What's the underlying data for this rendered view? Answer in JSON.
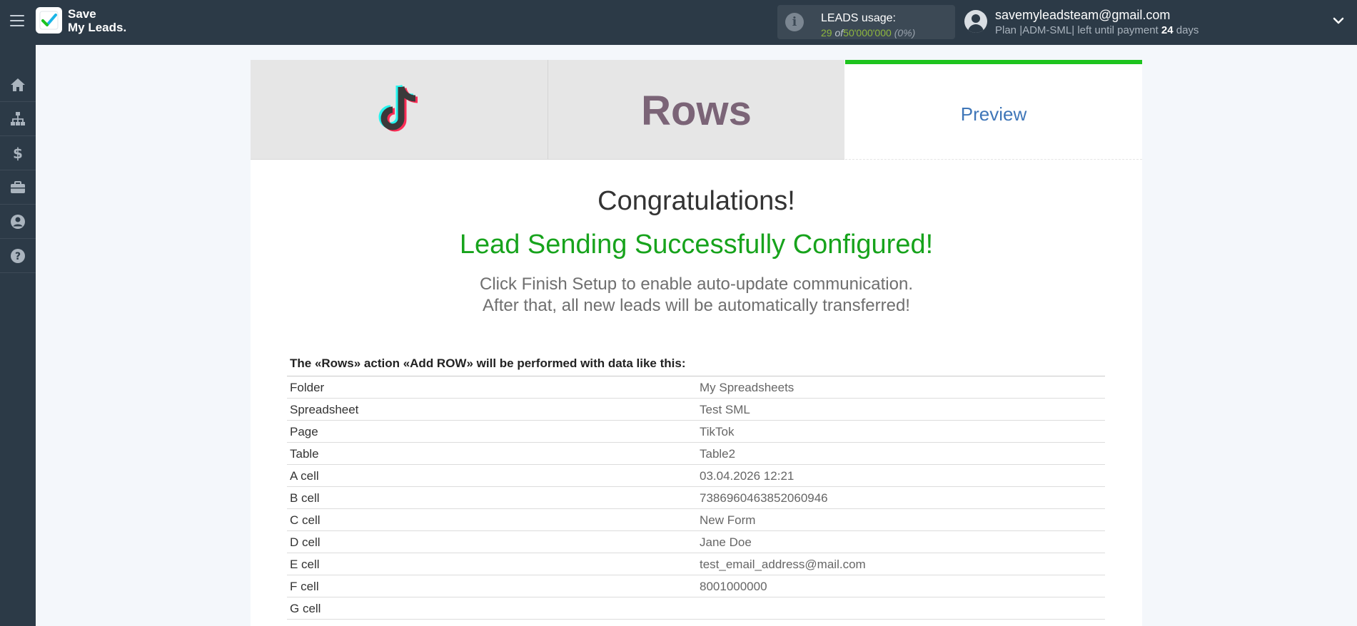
{
  "header": {
    "logo_line1": "Save",
    "logo_line2": "My Leads.",
    "usage_title": "LEADS usage:",
    "usage_used": "29",
    "usage_of": "of",
    "usage_total": "50'000'000",
    "usage_pct": "(0%)",
    "email": "savemyleadsteam@gmail.com",
    "plan_prefix": "Plan |ADM-SML| left until payment",
    "plan_days": "24",
    "plan_suffix": "days"
  },
  "sidebar": {
    "items": [
      "home-icon",
      "sitemap-icon",
      "dollar-icon",
      "briefcase-icon",
      "user-icon",
      "help-icon"
    ]
  },
  "tabs": {
    "source": "TikTok",
    "destination": "Rows",
    "preview": "Preview"
  },
  "message": {
    "congrats": "Congratulations!",
    "success": "Lead Sending Successfully Configured!",
    "hint_line1": "Click Finish Setup to enable auto-update communication.",
    "hint_line2": "After that, all new leads will be automatically transferred!"
  },
  "table": {
    "title": "The «Rows» action «Add ROW» will be performed with data like this:",
    "rows": [
      {
        "key": "Folder",
        "value": "My Spreadsheets"
      },
      {
        "key": "Spreadsheet",
        "value": "Test SML"
      },
      {
        "key": "Page",
        "value": "TikTok"
      },
      {
        "key": "Table",
        "value": "Table2"
      },
      {
        "key": "A cell",
        "value": "03.04.2026 12:21"
      },
      {
        "key": "B cell",
        "value": "7386960463852060946"
      },
      {
        "key": "C cell",
        "value": "New Form"
      },
      {
        "key": "D cell",
        "value": "Jane Doe"
      },
      {
        "key": "E cell",
        "value": "test_email_address@mail.com"
      },
      {
        "key": "F cell",
        "value": "8001000000"
      },
      {
        "key": "G cell",
        "value": ""
      }
    ]
  },
  "colors": {
    "topbar": "#2c3a47",
    "accent_green": "#1ec41e",
    "success_text": "#17a31c",
    "link_blue": "#3f76b8",
    "rows_brand": "#7b6477"
  }
}
